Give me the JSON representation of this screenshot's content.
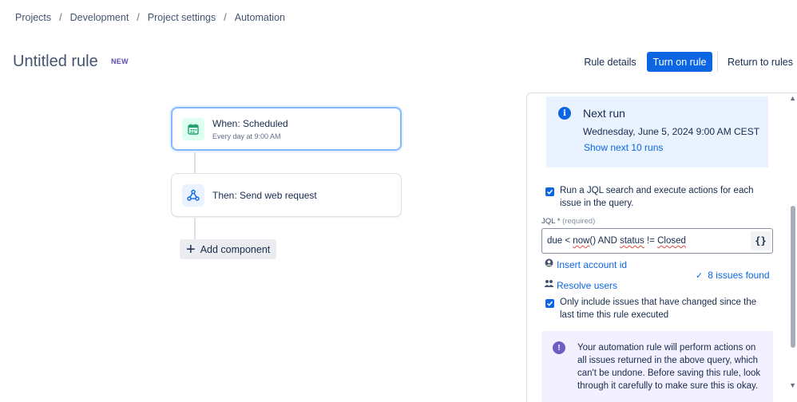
{
  "breadcrumb": {
    "items": [
      "Projects",
      "Development",
      "Project settings",
      "Automation"
    ],
    "separator": "/"
  },
  "rule": {
    "title": "Untitled rule",
    "badge": "NEW"
  },
  "header_actions": {
    "rule_details": "Rule details",
    "turn_on": "Turn on rule",
    "return": "Return to rules"
  },
  "flow": {
    "trigger": {
      "title": "When: Scheduled",
      "subtitle": "Every day at 9:00 AM",
      "icon": "calendar-icon"
    },
    "action": {
      "title": "Then: Send web request",
      "icon": "webhook-icon"
    },
    "add_component": "Add component"
  },
  "panel": {
    "next_run": {
      "title": "Next run",
      "date": "Wednesday, June 5, 2024 9:00 AM CEST",
      "link": "Show next 10 runs"
    },
    "run_jql_checkbox": {
      "checked": true,
      "label": "Run a JQL search and execute actions for each issue in the query."
    },
    "jql": {
      "label": "JQL",
      "asterisk": "*",
      "required": "(required)",
      "value_parts": [
        "due < ",
        "now",
        "() AND ",
        "status",
        " != ",
        "Closed"
      ],
      "braces": "{}"
    },
    "insert_account_id": "Insert account id",
    "resolve_users": "Resolve users",
    "issues_found": "8 issues found",
    "only_changed_checkbox": {
      "checked": true,
      "label": "Only include issues that have changed since the last time this rule executed"
    },
    "warning": "Your automation rule will perform actions on all issues returned in the above query, which can't be undone. Before saving this rule, look through it carefully to make sure this is okay."
  },
  "colors": {
    "primary": "#0c66e4",
    "info_bg": "#e9f2ff",
    "warning_bg": "#f3f0ff",
    "discovery": "#6e5dc6",
    "badge": "#5e4db2"
  }
}
